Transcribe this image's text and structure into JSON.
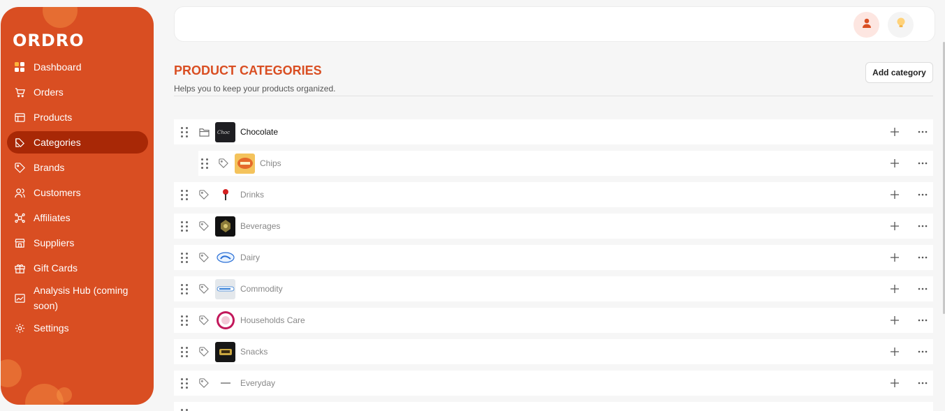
{
  "brand": {
    "logo": "ORDRO",
    "accent": "#d94e22",
    "active_bg": "#a82806"
  },
  "sidebar": {
    "items": [
      {
        "label": "Dashboard",
        "icon": "grid-icon"
      },
      {
        "label": "Orders",
        "icon": "cart-icon"
      },
      {
        "label": "Products",
        "icon": "box-icon"
      },
      {
        "label": "Categories",
        "icon": "category-icon",
        "active": true
      },
      {
        "label": "Brands",
        "icon": "tag-icon"
      },
      {
        "label": "Customers",
        "icon": "users-icon"
      },
      {
        "label": "Affiliates",
        "icon": "network-icon"
      },
      {
        "label": "Suppliers",
        "icon": "store-icon"
      },
      {
        "label": "Gift Cards",
        "icon": "gift-icon"
      },
      {
        "label": "Analysis Hub (coming soon)",
        "icon": "chart-icon"
      },
      {
        "label": "Settings",
        "icon": "gear-icon"
      }
    ]
  },
  "header": {
    "user_icon": "user-icon",
    "bulb_icon": "bulb-icon"
  },
  "page": {
    "title": "PRODUCT CATEGORIES",
    "subtitle": "Helps you to keep your products organized.",
    "add_button": "Add category"
  },
  "categories": [
    {
      "name": "Chocolate",
      "icon": "folder-icon",
      "level": 0
    },
    {
      "name": "Chips",
      "icon": "tag-icon",
      "level": 1
    },
    {
      "name": "Drinks",
      "icon": "tag-icon",
      "level": 0
    },
    {
      "name": "Beverages",
      "icon": "tag-icon",
      "level": 0
    },
    {
      "name": "Dairy",
      "icon": "tag-icon",
      "level": 0
    },
    {
      "name": "Commodity",
      "icon": "tag-icon",
      "level": 0
    },
    {
      "name": "Households Care",
      "icon": "tag-icon",
      "level": 0
    },
    {
      "name": "Snacks",
      "icon": "tag-icon",
      "level": 0
    },
    {
      "name": "Everyday",
      "icon": "tag-icon",
      "level": 0
    }
  ]
}
